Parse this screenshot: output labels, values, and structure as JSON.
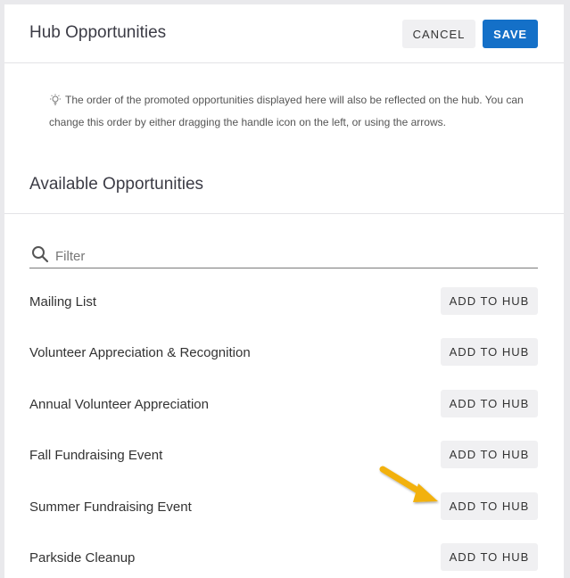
{
  "header": {
    "title": "Hub Opportunities",
    "cancel_label": "CANCEL",
    "save_label": "SAVE"
  },
  "tip": {
    "icon": "lightbulb-icon",
    "text": "The order of the promoted opportunities displayed here will also be reflected on the hub. You can change this order by either dragging the handle icon on the left, or using the arrows."
  },
  "available": {
    "title": "Available Opportunities",
    "filter_placeholder": "Filter",
    "filter_value": "",
    "items": [
      {
        "label": "Mailing List",
        "button": "ADD TO HUB"
      },
      {
        "label": "Volunteer Appreciation & Recognition",
        "button": "ADD TO HUB"
      },
      {
        "label": "Annual Volunteer Appreciation",
        "button": "ADD TO HUB"
      },
      {
        "label": "Fall Fundraising Event",
        "button": "ADD TO HUB"
      },
      {
        "label": "Summer Fundraising Event",
        "button": "ADD TO HUB"
      },
      {
        "label": "Parkside Cleanup",
        "button": "ADD TO HUB"
      }
    ]
  },
  "colors": {
    "primary": "#1470c8",
    "secondary_button": "#f0f0f2",
    "annotation_arrow": "#f2b10f"
  }
}
